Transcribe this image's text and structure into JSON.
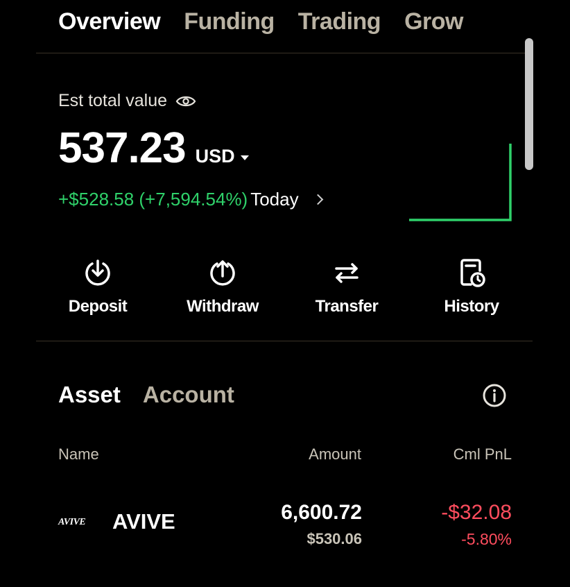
{
  "colors": {
    "background": "#000000",
    "positive": "#2fd16a",
    "negative": "#ff4d5e",
    "muted_text": "#b9b2a3"
  },
  "top_tabs": [
    {
      "label": "Overview",
      "active": true
    },
    {
      "label": "Funding",
      "active": false
    },
    {
      "label": "Trading",
      "active": false
    },
    {
      "label": "Grow",
      "active": false
    }
  ],
  "balance": {
    "label": "Est total value",
    "icon": "eye-icon",
    "value": "537.23",
    "currency": "USD",
    "pnl_change": "+$528.58 (+7,594.54%)",
    "pnl_period": "Today"
  },
  "actions": [
    {
      "label": "Deposit",
      "icon": "deposit-icon"
    },
    {
      "label": "Withdraw",
      "icon": "withdraw-icon"
    },
    {
      "label": "Transfer",
      "icon": "transfer-icon"
    },
    {
      "label": "History",
      "icon": "history-icon"
    }
  ],
  "sub_tabs": [
    {
      "label": "Asset",
      "active": true
    },
    {
      "label": "Account",
      "active": false
    }
  ],
  "table": {
    "columns": [
      "Name",
      "Amount",
      "Cml PnL"
    ],
    "rows": [
      {
        "logo_text": "AVIVE",
        "name": "AVIVE",
        "amount": "6,600.72",
        "amount_usd": "$530.06",
        "pnl": "-$32.08",
        "pnl_pct": "-5.80%"
      }
    ]
  }
}
